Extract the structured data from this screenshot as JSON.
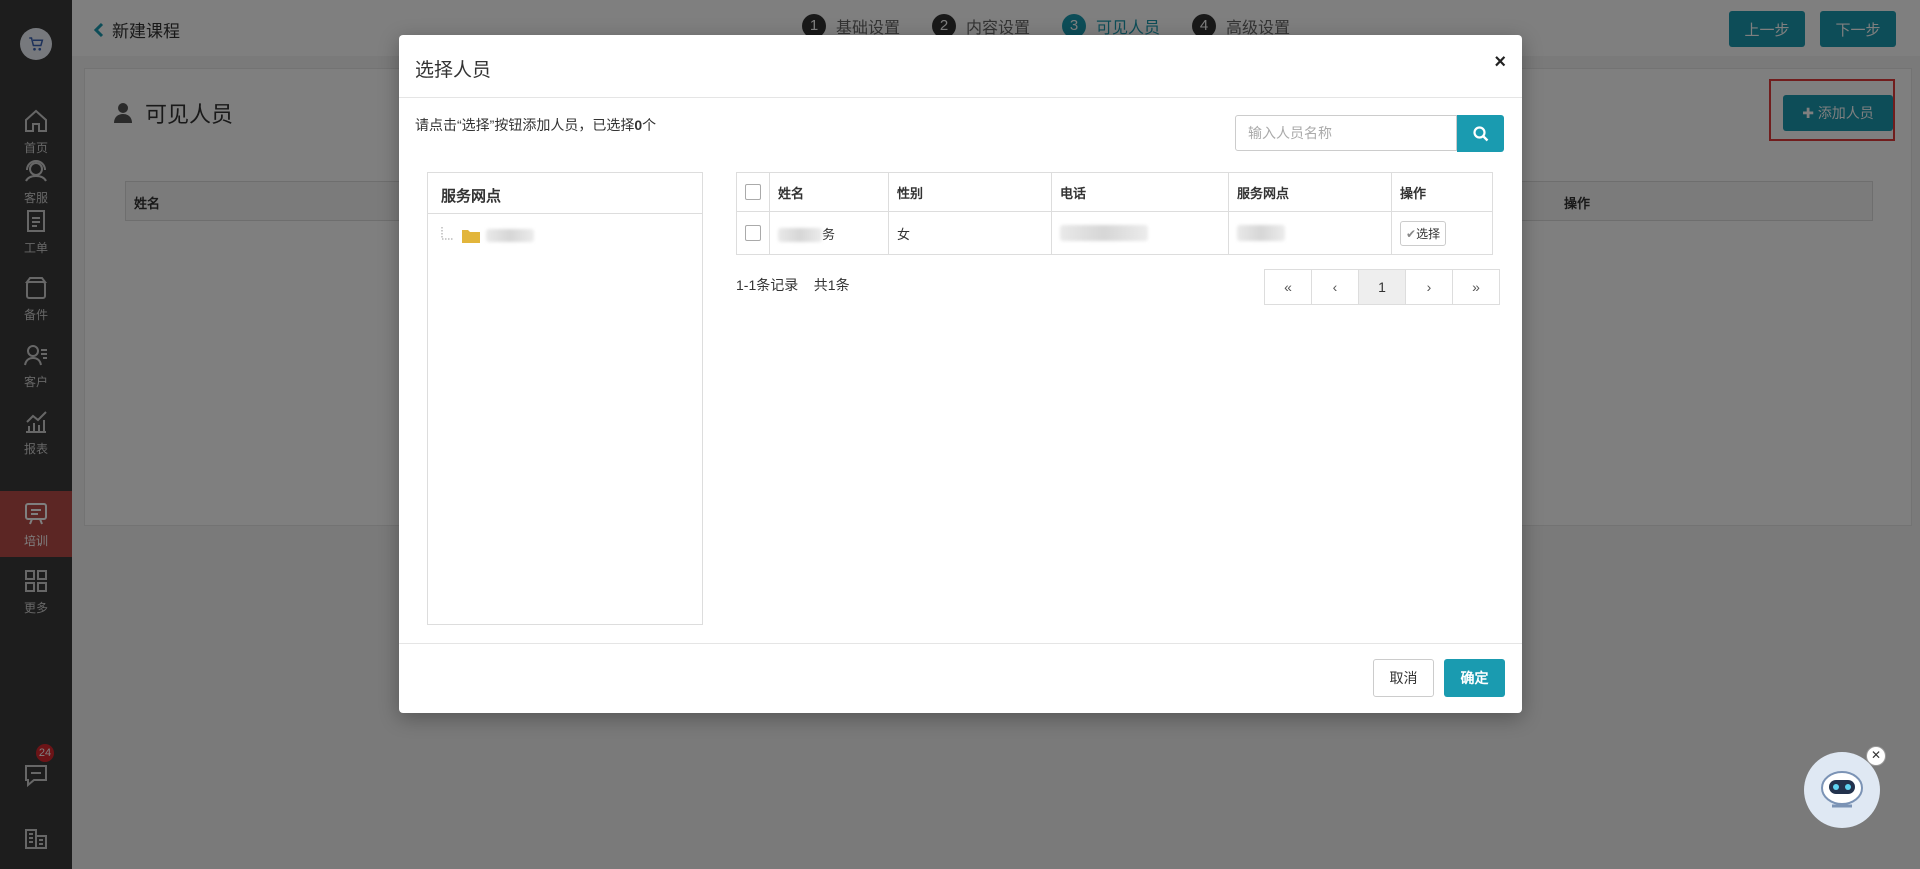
{
  "sidebar": {
    "items": [
      {
        "label": "首页",
        "icon": "home-icon"
      },
      {
        "label": "客服",
        "icon": "headset-icon"
      },
      {
        "label": "工单",
        "icon": "clipboard-icon"
      },
      {
        "label": "备件",
        "icon": "box-icon"
      },
      {
        "label": "客户",
        "icon": "users-icon"
      },
      {
        "label": "报表",
        "icon": "chart-icon"
      },
      {
        "label": "培训",
        "icon": "training-icon"
      },
      {
        "label": "更多",
        "icon": "grid-icon"
      }
    ],
    "message_badge": "24"
  },
  "topbar": {
    "back_label": "新建课程",
    "steps": [
      {
        "num": "1",
        "label": "基础设置"
      },
      {
        "num": "2",
        "label": "内容设置"
      },
      {
        "num": "3",
        "label": "可见人员"
      },
      {
        "num": "4",
        "label": "高级设置"
      }
    ],
    "prev_label": "上一步",
    "next_label": "下一步"
  },
  "page": {
    "title": "可见人员",
    "add_button": "添加人员",
    "columns": {
      "name": "姓名",
      "action": "操作"
    }
  },
  "modal": {
    "title": "选择人员",
    "close": "×",
    "hint_prefix": "请点击“选择”按钮添加人员，已选择",
    "hint_count": "0",
    "hint_suffix": "个",
    "search_placeholder": "输入人员名称",
    "tree_title": "服务网点",
    "table": {
      "headers": [
        "姓名",
        "性别",
        "电话",
        "服务网点",
        "操作"
      ],
      "row": {
        "name_tail": "务",
        "gender": "女",
        "select_label": "选择"
      }
    },
    "records": "1-1条记录",
    "total": "共1条",
    "pager": {
      "first": "«",
      "prev": "‹",
      "current": "1",
      "next": "›",
      "last": "»"
    },
    "cancel_label": "取消",
    "ok_label": "确定"
  },
  "colors": {
    "accent": "#1a9bb0",
    "active_nav": "#b94d48",
    "highlight": "#e23b3b"
  }
}
